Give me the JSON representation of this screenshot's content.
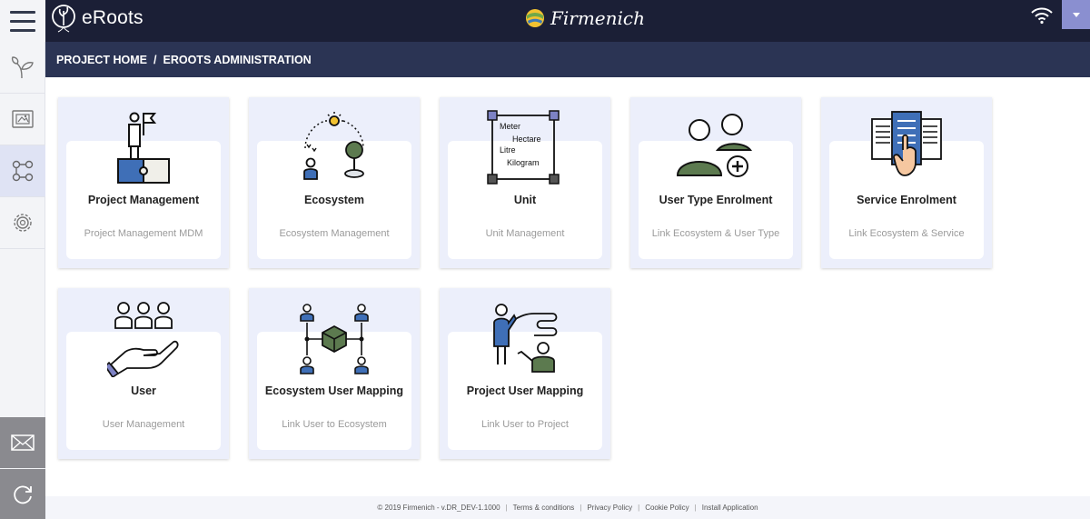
{
  "app": {
    "name": "eRoots",
    "partner": "Firmenich"
  },
  "breadcrumb": {
    "home": "PROJECT HOME",
    "separator": "/",
    "current": "EROOTS ADMINISTRATION"
  },
  "sidebar": {
    "items": [
      {
        "icon": "leaf-sprout-icon"
      },
      {
        "icon": "image-frame-icon"
      },
      {
        "icon": "workflow-icon",
        "active": true
      },
      {
        "icon": "settings-gear-icon"
      }
    ],
    "bottom": [
      {
        "icon": "mail-icon"
      },
      {
        "icon": "refresh-icon"
      }
    ]
  },
  "tiles": [
    {
      "title": "Project Management",
      "desc": "Project Management MDM",
      "icon": "project-flag-icon"
    },
    {
      "title": "Ecosystem",
      "desc": "Ecosystem Management",
      "icon": "ecosystem-icon"
    },
    {
      "title": "Unit",
      "desc": "Unit Management",
      "icon": "unit-icon",
      "unit_words": [
        "Meter",
        "Hectare",
        "Litre",
        "Kilogram"
      ]
    },
    {
      "title": "User Type Enrolment",
      "desc": "Link Ecosystem & User Type",
      "icon": "user-type-icon"
    },
    {
      "title": "Service Enrolment",
      "desc": "Link Ecosystem & Service",
      "icon": "service-icon"
    },
    {
      "title": "User",
      "desc": "User Management",
      "icon": "user-group-icon"
    },
    {
      "title": "Ecosystem User Mapping",
      "desc": "Link User to Ecosystem",
      "icon": "network-mapping-icon"
    },
    {
      "title": "Project User Mapping",
      "desc": "Link User to Project",
      "icon": "presentation-icon"
    }
  ],
  "footer": {
    "copyright": "© 2019 Firmenich - v.DR_DEV-1.1000",
    "links": [
      "Terms & conditions",
      "Privacy Policy",
      "Cookie Policy",
      "Install Application"
    ]
  },
  "colors": {
    "topbar": "#1b1f36",
    "breadcrumb": "#2b3454",
    "tile_bg": "#eceffb",
    "accent_blue": "#3f6fb7",
    "accent_green": "#5c7a4f"
  }
}
